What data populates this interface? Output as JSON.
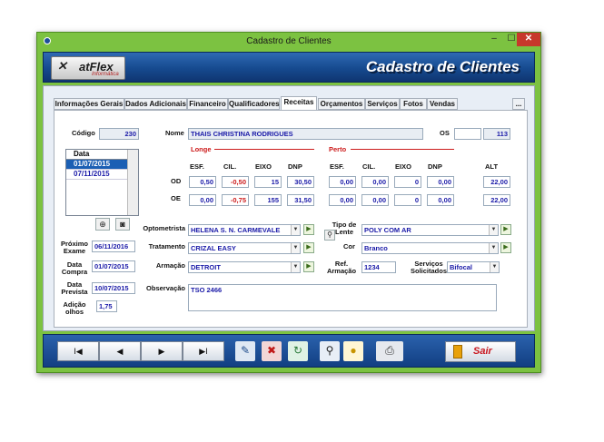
{
  "window": {
    "title": "Cadastro de Clientes",
    "min": "–",
    "max": "☐",
    "close": "✕"
  },
  "banner": {
    "logo_text": "atFlex",
    "logo_sub": "Informática",
    "title": "Cadastro de Clientes"
  },
  "tabs": [
    "Informações Gerais",
    "Dados Adicionais",
    "Financeiro",
    "Qualificadores",
    "Receitas",
    "Orçamentos",
    "Serviços",
    "Fotos",
    "Vendas"
  ],
  "tab_more": "...",
  "form": {
    "codigo_label": "Código",
    "codigo": "230",
    "nome_label": "Nome",
    "nome": "THAIS CHRISTINA RODRIGUES",
    "os_label": "OS",
    "os": "",
    "os2": "113",
    "longe": "Longe",
    "perto": "Perto",
    "cols": [
      "ESF.",
      "CIL.",
      "EIXO",
      "DNP"
    ],
    "alt": "ALT",
    "od": "OD",
    "oe": "OE",
    "longe_od": [
      "0,50",
      "-0,50",
      "15",
      "30,50"
    ],
    "longe_oe": [
      "0,00",
      "-0,75",
      "155",
      "31,50"
    ],
    "perto_od": [
      "0,00",
      "0,00",
      "0",
      "0,00"
    ],
    "perto_oe": [
      "0,00",
      "0,00",
      "0",
      "0,00"
    ],
    "alt_od": "22,00",
    "alt_oe": "22,00",
    "data_header": "Data",
    "dates": [
      "01/07/2015",
      "07/11/2015"
    ],
    "optometrista_label": "Optometrista",
    "optometrista": "HELENA S. N. CARMEVALE",
    "tratamento_label": "Tratamento",
    "tratamento": "CRIZAL EASY",
    "armacao_label": "Armação",
    "armacao": "DETROIT",
    "observacao_label": "Observação",
    "observacao": "TSO 2466",
    "tipo_lente_label_1": "Tipo de",
    "tipo_lente_label_2": "Lente",
    "tipo_lente": "POLY COM AR",
    "cor_label": "Cor",
    "cor": "Branco",
    "ref_label_1": "Ref.",
    "ref_label_2": "Armação",
    "ref": "1234",
    "servicos_label_1": "Serviços",
    "servicos_label_2": "Solicitados",
    "servicos": "Bifocal",
    "proximo_label_1": "Próximo",
    "proximo_label_2": "Exame",
    "proximo": "06/11/2016",
    "compra_label_1": "Data",
    "compra_label_2": "Compra",
    "compra": "01/07/2015",
    "prevista_label_1": "Data",
    "prevista_label_2": "Prevista",
    "prevista": "10/07/2015",
    "adicao_label_1": "Adição",
    "adicao_label_2": "olhos",
    "adicao": "1,75"
  },
  "footer": {
    "first": "I◀",
    "prev": "◀",
    "next": "▶",
    "last": "▶I",
    "sair": "Sair"
  }
}
